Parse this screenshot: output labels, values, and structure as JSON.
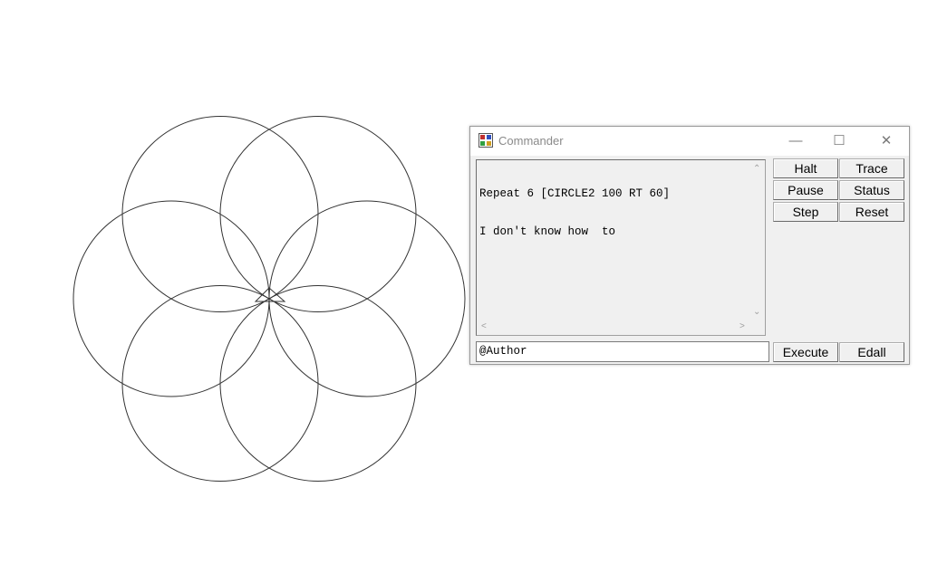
{
  "window": {
    "title": "Commander",
    "minimize_icon": "minimize-icon",
    "maximize_icon": "maximize-icon",
    "close_icon": "close-icon"
  },
  "output": {
    "lines": [
      "Repeat 6 [CIRCLE2 100 RT 60]",
      "I don't know how  to"
    ]
  },
  "input": {
    "value": "@Author"
  },
  "buttons": {
    "halt": "Halt",
    "trace": "Trace",
    "pause": "Pause",
    "status": "Status",
    "step": "Step",
    "reset": "Reset",
    "execute": "Execute",
    "edall": "Edall"
  },
  "drawing": {
    "shape": "six overlapping circles with turtle at center",
    "circle_count": 6,
    "stroke_color": "#333333",
    "turtle_icon": "turtle-triangle-icon"
  }
}
